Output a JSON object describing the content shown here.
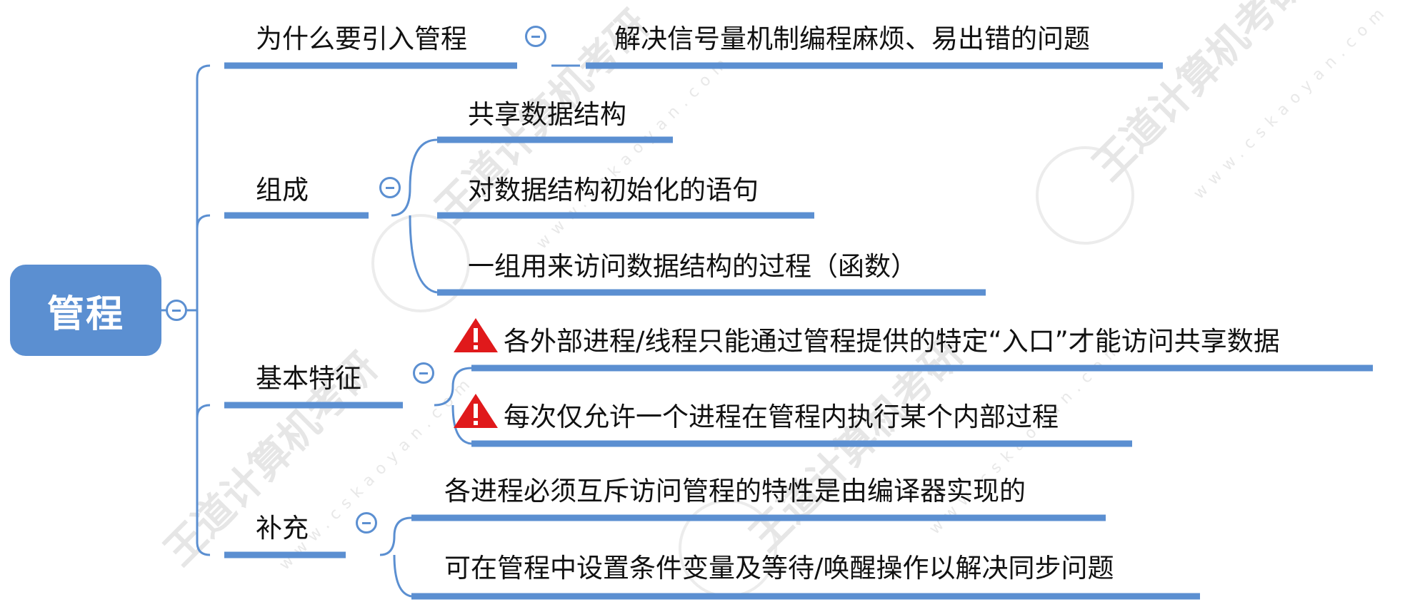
{
  "root": {
    "label": "管程"
  },
  "branches": [
    {
      "label": "为什么要引入管程",
      "children": [
        {
          "label": "解决信号量机制编程麻烦、易出错的问题"
        }
      ]
    },
    {
      "label": "组成",
      "children": [
        {
          "label": "共享数据结构"
        },
        {
          "label": "对数据结构初始化的语句"
        },
        {
          "label": "一组用来访问数据结构的过程（函数）"
        }
      ]
    },
    {
      "label": "基本特征",
      "children": [
        {
          "label": "各外部进程/线程只能通过管程提供的特定“入口”才能访问共享数据",
          "icon": "warning-icon"
        },
        {
          "label": "每次仅允许一个进程在管程内执行某个内部过程",
          "icon": "warning-icon"
        }
      ]
    },
    {
      "label": "补充",
      "children": [
        {
          "label": "各进程必须互斥访问管程的特性是由编译器实现的"
        },
        {
          "label": "可在管程中设置条件变量及等待/唤醒操作以解决同步问题"
        }
      ]
    }
  ],
  "watermark": {
    "brand": "王道计算机考研",
    "site": "www.cskaoyan.com"
  },
  "colors": {
    "accent": "#5b8fd1",
    "warning": "#e0191b",
    "text": "#111111"
  }
}
